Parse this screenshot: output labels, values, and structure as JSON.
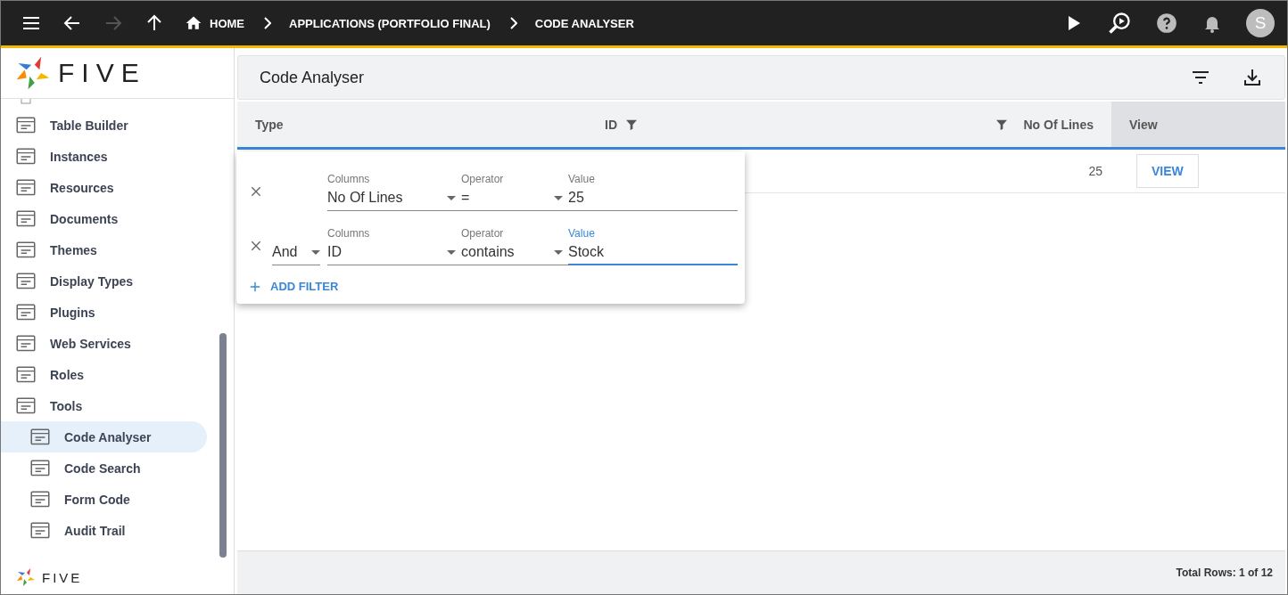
{
  "topbar": {
    "breadcrumbs": [
      {
        "label": "HOME",
        "kind": "home"
      },
      {
        "label": "APPLICATIONS (PORTFOLIO FINAL)",
        "kind": "crumb"
      },
      {
        "label": "CODE ANALYSER",
        "kind": "crumb"
      }
    ],
    "avatar": "S"
  },
  "logo": {
    "text": "FIVE"
  },
  "sidebar": {
    "items": [
      {
        "label": "Table Builder",
        "selected": false
      },
      {
        "label": "Instances",
        "selected": false
      },
      {
        "label": "Resources",
        "selected": false
      },
      {
        "label": "Documents",
        "selected": false
      },
      {
        "label": "Themes",
        "selected": false
      },
      {
        "label": "Display Types",
        "selected": false
      },
      {
        "label": "Plugins",
        "selected": false
      },
      {
        "label": "Web Services",
        "selected": false
      },
      {
        "label": "Roles",
        "selected": false
      },
      {
        "label": "Tools",
        "selected": false,
        "children": [
          {
            "label": "Code Analyser",
            "selected": true
          },
          {
            "label": "Code Search",
            "selected": false
          },
          {
            "label": "Form Code",
            "selected": false
          },
          {
            "label": "Audit Trail",
            "selected": false
          }
        ]
      }
    ],
    "footer_logo": "FIVE"
  },
  "page": {
    "title": "Code Analyser"
  },
  "table": {
    "columns": [
      {
        "label": "Type",
        "filter": false,
        "selected": false
      },
      {
        "label": "ID",
        "filter": true,
        "selected": false
      },
      {
        "label": "No Of Lines",
        "filter": true,
        "selected": false
      },
      {
        "label": "View",
        "filter": false,
        "selected": true
      }
    ],
    "rows": [
      {
        "no_of_lines": "25",
        "action": "VIEW"
      }
    ]
  },
  "filter_panel": {
    "rows": [
      {
        "conjunction": null,
        "column_label": "Columns",
        "column": "No Of Lines",
        "operator_label": "Operator",
        "operator": "=",
        "value_label": "Value",
        "value": "25",
        "focused": false
      },
      {
        "conjunction": "And",
        "column_label": "Columns",
        "column": "ID",
        "operator_label": "Operator",
        "operator": "contains",
        "value_label": "Value",
        "value": "Stock",
        "focused": true
      }
    ],
    "add_label": "ADD FILTER"
  },
  "status_bar": {
    "total": "Total Rows: 1 of 12"
  }
}
